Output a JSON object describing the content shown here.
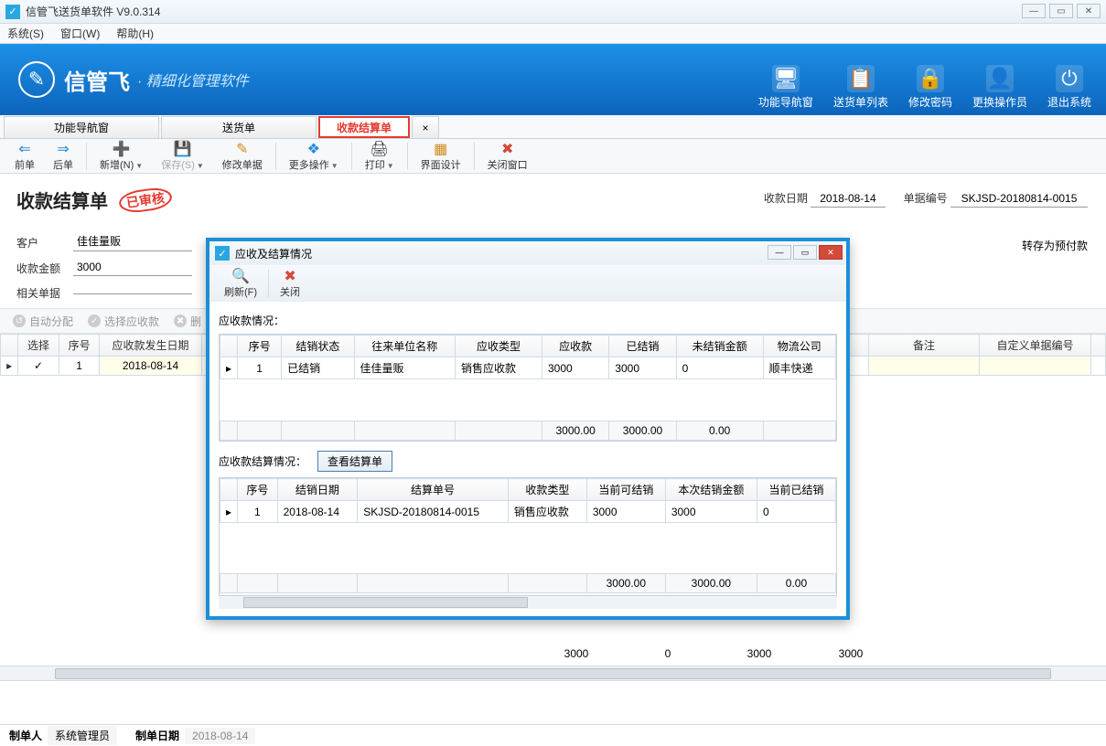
{
  "app": {
    "title": "信管飞送货单软件 V9.0.314"
  },
  "menus": [
    "系统(S)",
    "窗口(W)",
    "帮助(H)"
  ],
  "brand": {
    "name": "信管飞",
    "sub": "· 精细化管理软件"
  },
  "banner_actions": [
    {
      "icon": "🖥",
      "label": "功能导航窗"
    },
    {
      "icon": "📋",
      "label": "送货单列表"
    },
    {
      "icon": "🔒",
      "label": "修改密码"
    },
    {
      "icon": "👤",
      "label": "更换操作员"
    },
    {
      "icon": "⏻",
      "label": "退出系统"
    }
  ],
  "doc_tabs": [
    {
      "label": "功能导航窗"
    },
    {
      "label": "送货单"
    },
    {
      "label": "收款结算单",
      "active": true
    },
    {
      "label": "×",
      "narrow": true
    }
  ],
  "toolbar": [
    {
      "icon": "⇐",
      "label": "前单",
      "color": "#2a8ad6"
    },
    {
      "icon": "⇒",
      "label": "后单",
      "color": "#2a8ad6"
    },
    {
      "sep": true
    },
    {
      "icon": "➕",
      "label": "新增(N)",
      "color": "#2aa84a",
      "dd": true
    },
    {
      "icon": "💾",
      "label": "保存(S)",
      "disabled": true,
      "dd": true
    },
    {
      "icon": "✎",
      "label": "修改单据",
      "color": "#d28a1e"
    },
    {
      "sep": true
    },
    {
      "icon": "❖",
      "label": "更多操作",
      "color": "#2a8ad6",
      "dd": true
    },
    {
      "sep": true
    },
    {
      "icon": "🖨",
      "label": "打印",
      "color": "#555",
      "dd": true
    },
    {
      "sep": true
    },
    {
      "icon": "▦",
      "label": "界面设计",
      "color": "#d28a1e"
    },
    {
      "sep": true
    },
    {
      "icon": "✖",
      "label": "关闭窗口",
      "color": "#d44a3a"
    }
  ],
  "form": {
    "title": "收款结算单",
    "stamp": "已审核",
    "date_label": "收款日期",
    "date_value": "2018-08-14",
    "serial_label": "单据编号",
    "serial_value": "SKJSD-20180814-0015",
    "customer_label": "客户",
    "customer_value": "佳佳量贩",
    "amount_label": "收款金额",
    "amount_value": "3000",
    "related_label": "相关单据",
    "related_value": "",
    "right_note": "转存为预付款"
  },
  "subtool": [
    {
      "icon": "↺",
      "label": "自动分配"
    },
    {
      "icon": "✓",
      "label": "选择应收款"
    },
    {
      "icon": "✖",
      "label": "删"
    }
  ],
  "main_table": {
    "cols": [
      "选择",
      "序号",
      "应收款发生日期"
    ],
    "right_cols": [
      "备注",
      "自定义单据编号"
    ],
    "row": {
      "select": "✓",
      "seq": "1",
      "date": "2018-08-14"
    },
    "totals": [
      "3000",
      "0",
      "3000",
      "3000"
    ]
  },
  "footer": {
    "maker_label": "制单人",
    "maker_value": "系统管理员",
    "date_label": "制单日期",
    "date_value": "2018-08-14"
  },
  "dialog": {
    "title": "应收及结算情况",
    "tools": {
      "refresh": "刷新(F)",
      "close": "关闭"
    },
    "sec1_label": "应收款情况：",
    "t1_cols": [
      "序号",
      "结销状态",
      "往来单位名称",
      "应收类型",
      "应收款",
      "已结销",
      "未结销金额",
      "物流公司"
    ],
    "t1_row": [
      "1",
      "已结销",
      "佳佳量贩",
      "销售应收款",
      "3000",
      "3000",
      "0",
      "顺丰快递"
    ],
    "t1_foot": [
      "",
      "",
      "",
      "",
      "3000.00",
      "3000.00",
      "0.00",
      ""
    ],
    "sec2_label": "应收款结算情况：",
    "view_btn": "查看结算单",
    "t2_cols": [
      "序号",
      "结销日期",
      "结算单号",
      "收款类型",
      "当前可结销",
      "本次结销金额",
      "当前已结销"
    ],
    "t2_row": [
      "1",
      "2018-08-14",
      "SKJSD-20180814-0015",
      "销售应收款",
      "3000",
      "3000",
      "0"
    ],
    "t2_foot": [
      "",
      "",
      "",
      "",
      "3000.00",
      "3000.00",
      "0.00"
    ]
  }
}
